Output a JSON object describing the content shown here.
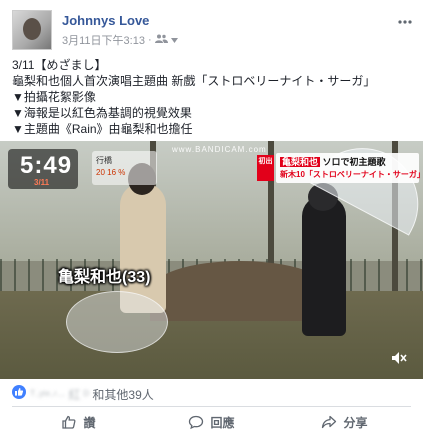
{
  "post": {
    "author": "Johnnys Love",
    "timestamp": "3月11日下午3:13",
    "audience_icon": "friends-icon",
    "body_lines": [
      "3/11【めざまし】",
      "龜梨和也個人首次演唱主題曲 新戲「ストロベリーナイト・サーガ」",
      "▼拍攝花絮影像",
      "▼海報是以紅色為基調的視覺效果",
      "▼主題曲《Rain》由龜梨和也擔任"
    ]
  },
  "video": {
    "clock_time": "5:49",
    "clock_date": "3/11",
    "weather_line1": "行橋",
    "weather_line2": "20 16 %",
    "watermark": "www.BANDICAM.com",
    "badge": "初出",
    "headline_name": "亀梨和也",
    "headline_rest": "ソロで初主題歌",
    "headline_line2": "新木10「ストロベリーナイト・サーガ」",
    "caption": "亀梨和也(33)",
    "muted": true
  },
  "reactions": {
    "names_blurred": "ᵀ·ʸᵗᵉ·ʳ·· 紅 ᴰ",
    "others": "和其他39人"
  },
  "actions": {
    "like_label": "讚",
    "comment_label": "回應",
    "share_label": "分享"
  },
  "colors": {
    "link": "#365899",
    "like_blue": "#4080ff",
    "news_red": "#e2001a"
  }
}
